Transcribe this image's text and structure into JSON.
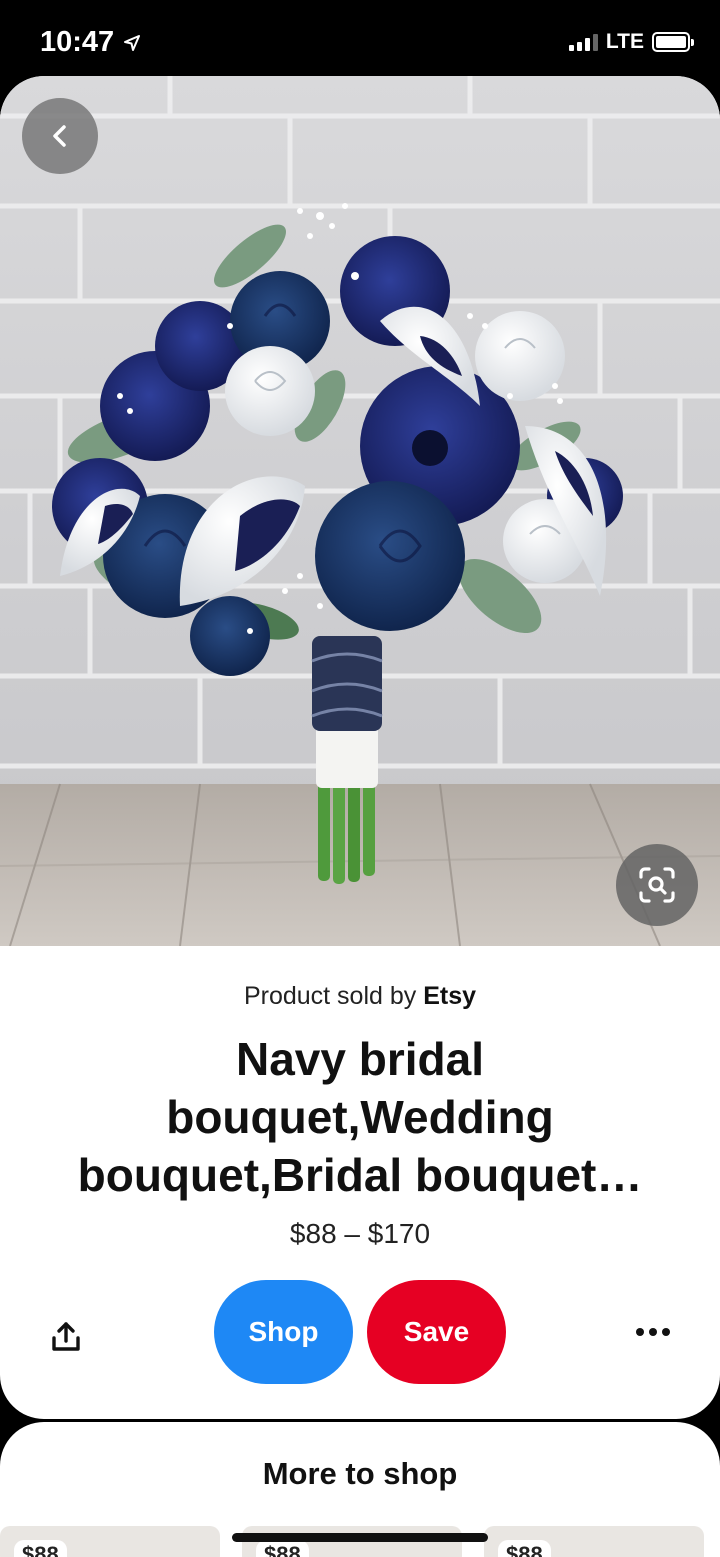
{
  "status_bar": {
    "time": "10:47",
    "network": "LTE"
  },
  "hero": {
    "back_icon": "chevron-left-icon",
    "lens_icon": "visual-search-icon"
  },
  "product": {
    "sold_by_prefix": "Product sold by ",
    "seller": "Etsy",
    "title": "Navy bridal bouquet,Wedding bouquet,Bridal bouquet…",
    "price": "$88 – $170"
  },
  "actions": {
    "share_icon": "share-icon",
    "shop_label": "Shop",
    "save_label": "Save",
    "more_icon": "more-options-icon",
    "shop_color": "#1e88f5",
    "save_color": "#e60023"
  },
  "more_to_shop": {
    "title": "More to shop",
    "items": [
      {
        "price": "$88"
      },
      {
        "price": "$88"
      },
      {
        "price": "$88"
      }
    ]
  }
}
